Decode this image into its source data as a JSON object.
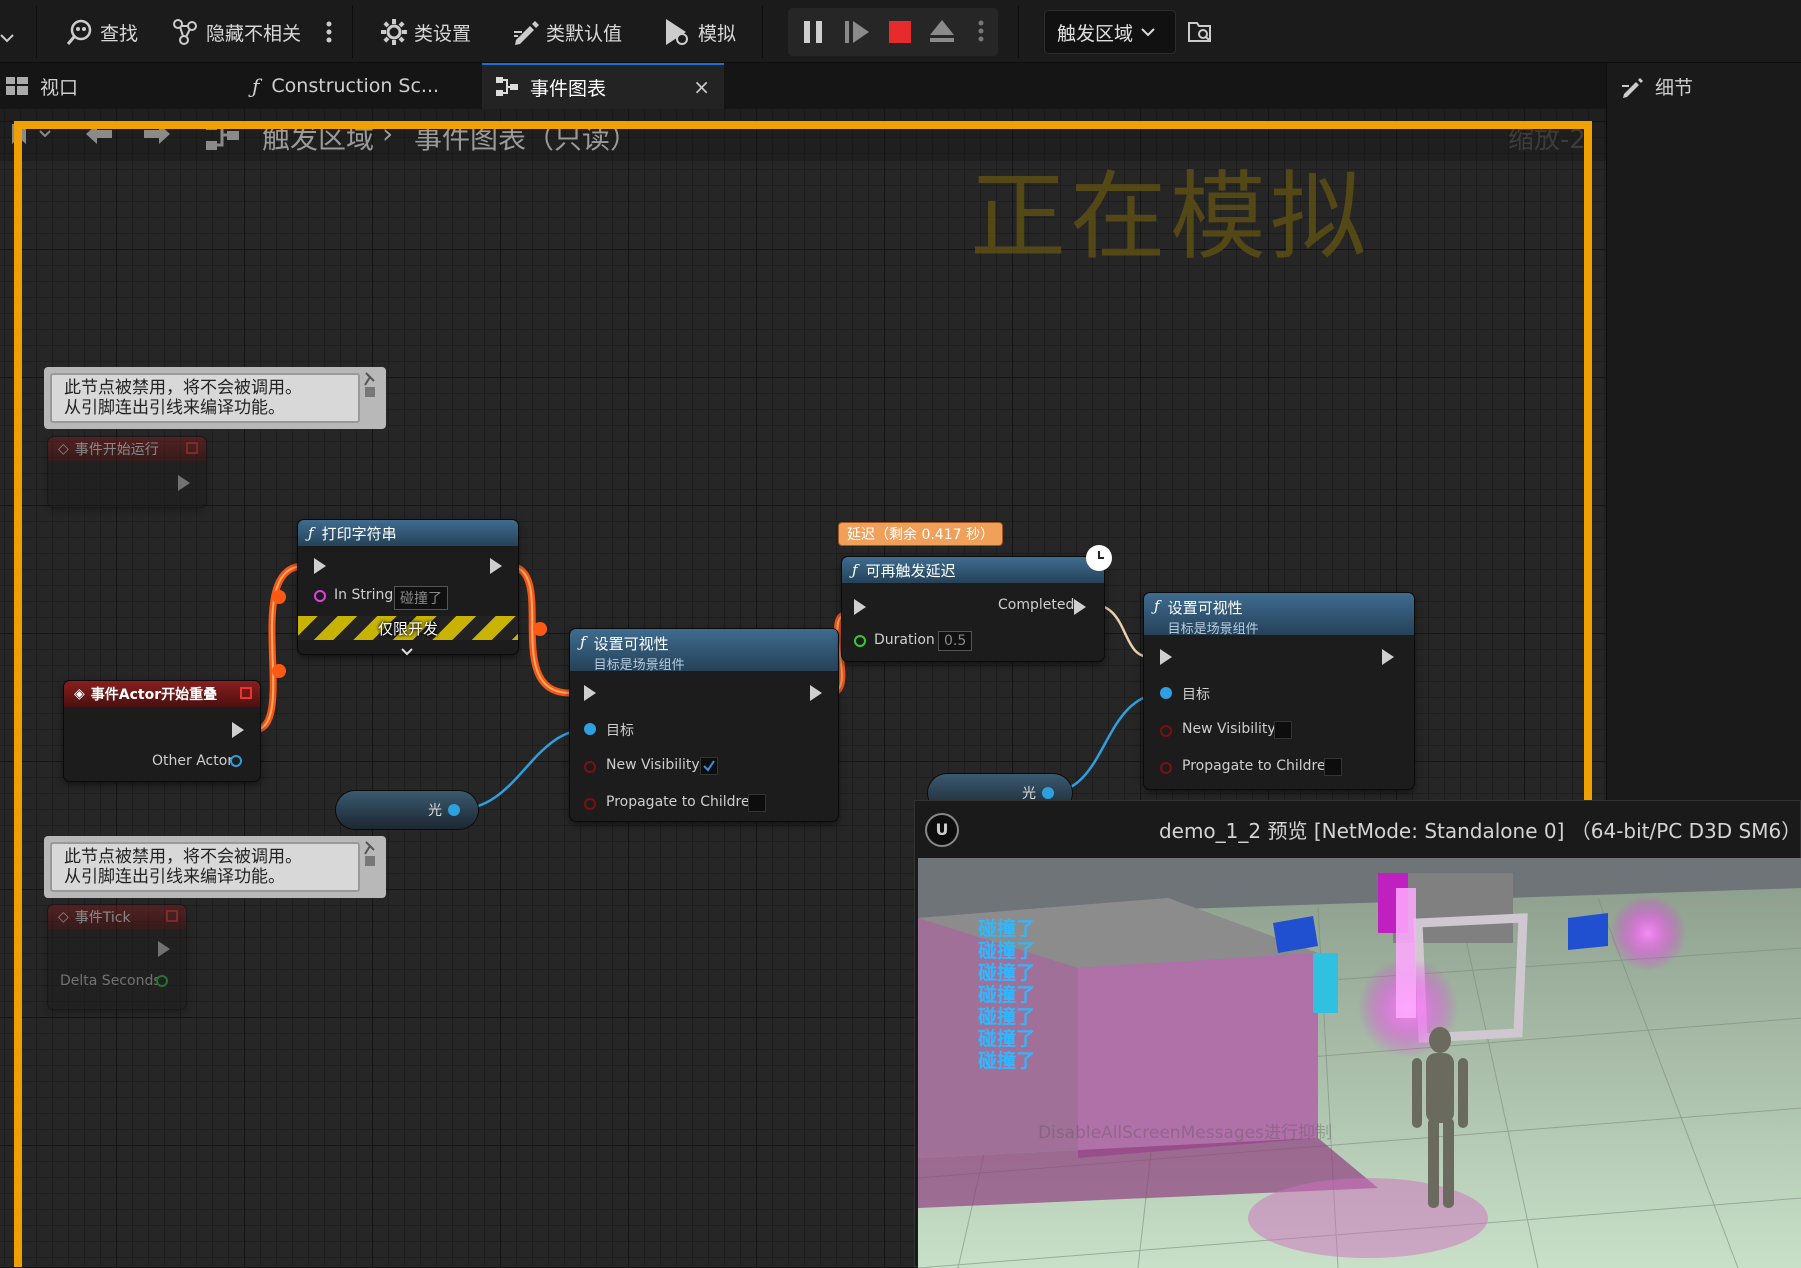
{
  "toolbar": {
    "find": "查找",
    "hide_unrelated": "隐藏不相关",
    "class_settings": "类设置",
    "class_defaults": "类默认值",
    "simulate": "模拟",
    "debug_target": "触发区域"
  },
  "tabs": {
    "viewport": "视口",
    "construction": "Construction Sc...",
    "event_graph": "事件图表",
    "details": "细节"
  },
  "breadcrumb": {
    "root": "触发区域",
    "current": "事件图表（只读）",
    "zoom": "缩放-2"
  },
  "graph": {
    "simulating_label": "正在模拟",
    "comment1_line1": "此节点被禁用，将不会被调用。",
    "comment1_line2": "从引脚连出引线来编译功能。",
    "comment2_line1": "此节点被禁用，将不会被调用。",
    "comment2_line2": "从引脚连出引线来编译功能。",
    "begin_play": "事件开始运行",
    "event_tick": "事件Tick",
    "delta_seconds": "Delta Seconds",
    "actor_overlap": "事件Actor开始重叠",
    "other_actor": "Other Actor",
    "print_string": "打印字符串",
    "in_string_label": "In String",
    "in_string_value": "碰撞了",
    "dev_only": "仅限开发",
    "set_vis1_title": "设置可视性",
    "set_vis1_sub": "目标是场景组件",
    "target": "目标",
    "new_visibility": "New Visibility",
    "propagate": "Propagate to Children",
    "light_var1": "光",
    "delay_badge": "延迟（剩余 0.417 秒）",
    "retrigger_delay": "可再触发延迟",
    "completed": "Completed",
    "duration_label": "Duration",
    "duration_value": "0.5",
    "set_vis2_title": "设置可视性",
    "set_vis2_sub": "目标是场景组件",
    "target2": "目标",
    "new_visibility2": "New Visibility",
    "propagate2": "Propagate to Children",
    "light_var2": "光"
  },
  "preview": {
    "title": "demo_1_2 预览 [NetMode: Standalone 0] （64-bit/PC D3D SM6）",
    "messages": [
      "碰撞了",
      "碰撞了",
      "碰撞了",
      "碰撞了",
      "碰撞了",
      "碰撞了",
      "碰撞了"
    ],
    "faded_hint": "DisableAllScreenMessages进行抑制"
  },
  "colors": {
    "accent": "#1b6fd6",
    "sim_frame": "#f0a000",
    "exec_wire": "#ff5a14",
    "data_wire": "#2ea0e0",
    "message": "#2fb8ff"
  }
}
